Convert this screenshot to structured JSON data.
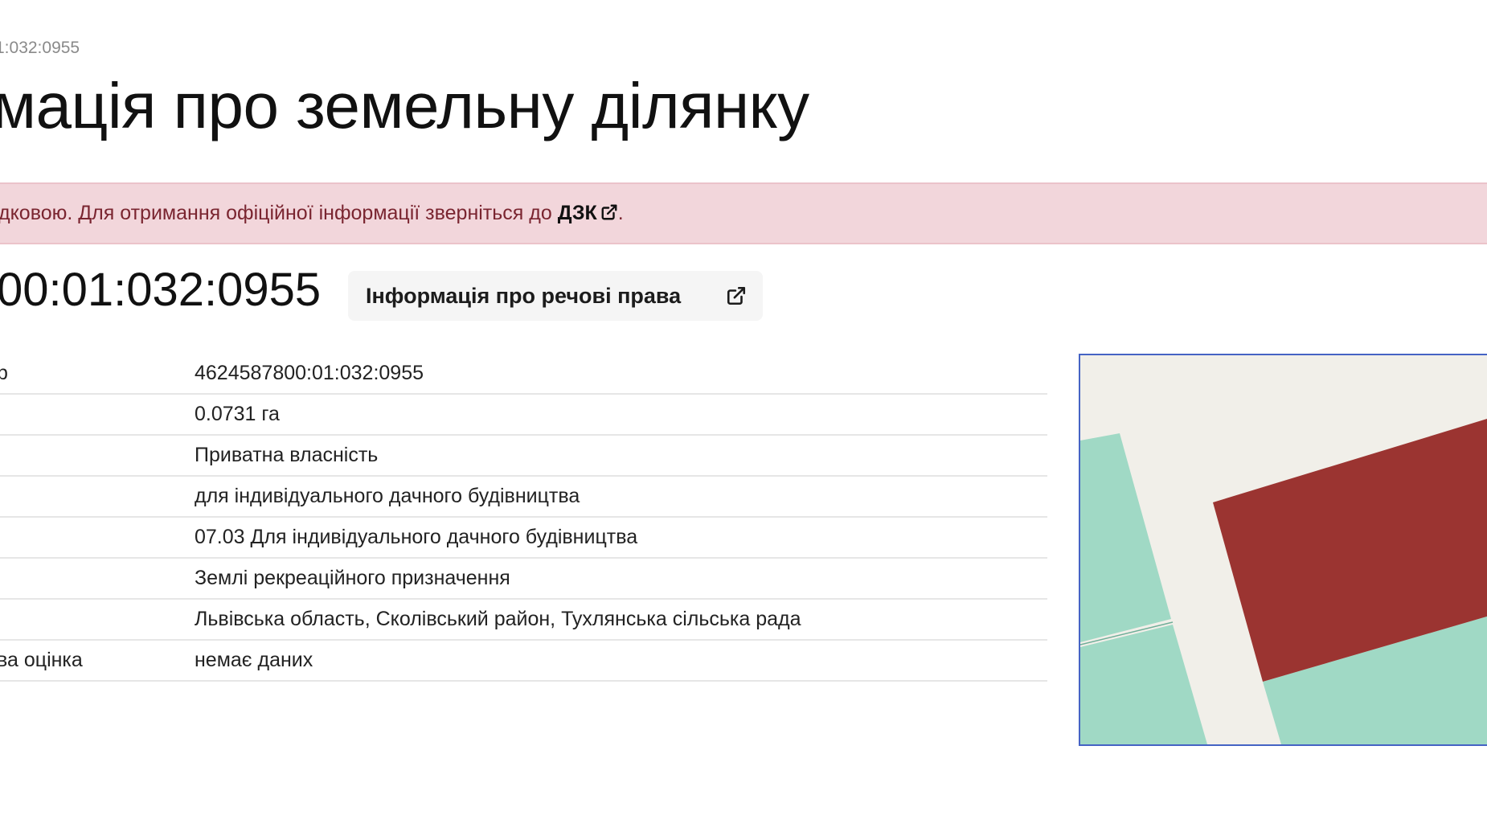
{
  "breadcrumb": "1:032:0955",
  "page_title": "мація про земельну ділянку",
  "alert": {
    "text": "дковою. Для отримання офіційної інформації зверніться до",
    "link_label": "ДЗК",
    "suffix": ".",
    "background": "#f2d6db"
  },
  "parcel": {
    "cad_number_display": "00:01:032:0955",
    "rights_button_label": "Інформація про речові права"
  },
  "table": {
    "rows": [
      {
        "label": "р",
        "value": "4624587800:01:032:0955"
      },
      {
        "label": "",
        "value": "0.0731 га"
      },
      {
        "label": "",
        "value": "Приватна власність"
      },
      {
        "label": "",
        "value": "для індивідуального дачного будівництва"
      },
      {
        "label": "",
        "value": "07.03 Для індивідуального дачного будівництва"
      },
      {
        "label": "",
        "value": "Землі рекреаційного призначення"
      },
      {
        "label": "",
        "value": "Львівська область, Сколівський район, Тухлянська сільська рада"
      },
      {
        "label": "ва оцінка",
        "value": "немає даних"
      }
    ]
  },
  "map": {
    "colors": {
      "background": "#f1efe9",
      "neighbor_parcel": "#a0d9c5",
      "selected_parcel": "#9b3431",
      "border": "#4563c4"
    }
  }
}
